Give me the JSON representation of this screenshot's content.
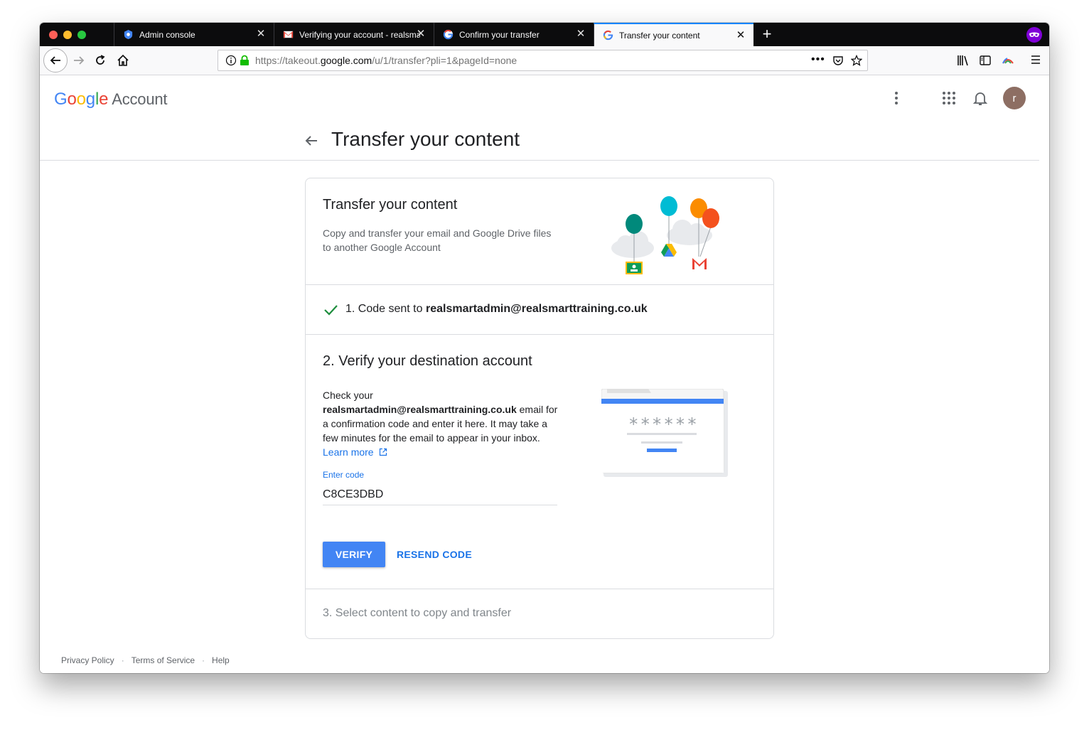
{
  "browser": {
    "tabs": [
      {
        "title": "Admin console",
        "icon": "admin-console-icon",
        "active": false
      },
      {
        "title": "Verifying your account - realsmart",
        "icon": "gmail-icon",
        "active": false
      },
      {
        "title": "Confirm your transfer",
        "icon": "google-icon",
        "active": false
      },
      {
        "title": "Transfer your content",
        "icon": "google-icon",
        "active": true
      }
    ],
    "url_prefix": "https://takeout.",
    "url_domain": "google.com",
    "url_path": "/u/1/transfer?pli=1&pageId=none",
    "private_color": "#8000d7"
  },
  "header": {
    "logo_letters": [
      "G",
      "o",
      "o",
      "g",
      "l",
      "e"
    ],
    "logo_suffix": "Account",
    "avatar_initial": "r",
    "avatar_color": "#8d6e63"
  },
  "page": {
    "title": "Transfer your content"
  },
  "card": {
    "title": "Transfer your content",
    "description": "Copy and transfer your email and Google Drive files to another Google Account",
    "step1": {
      "prefix": "1. Code sent to ",
      "email": "realsmartadmin@realsmarttraining.co.uk"
    },
    "step2": {
      "title": "2. Verify your destination account",
      "text_before": "Check your ",
      "email": "realsmartadmin@realsmarttraining.co.uk",
      "text_after": " email for a confirmation code and enter it here. It may take a few minutes for the email to appear in your inbox. ",
      "link": "Learn more",
      "field_label": "Enter code",
      "field_value": "C8CE3DBD",
      "password_mask": "******",
      "verify_label": "VERIFY",
      "resend_label": "RESEND CODE"
    },
    "step3": {
      "title": "3. Select content to copy and transfer"
    }
  },
  "footer": {
    "privacy": "Privacy Policy",
    "terms": "Terms of Service",
    "help": "Help",
    "separator": "·"
  },
  "colors": {
    "accent": "#1a73e8",
    "button": "#4285f4",
    "check": "#1e8e3e"
  }
}
